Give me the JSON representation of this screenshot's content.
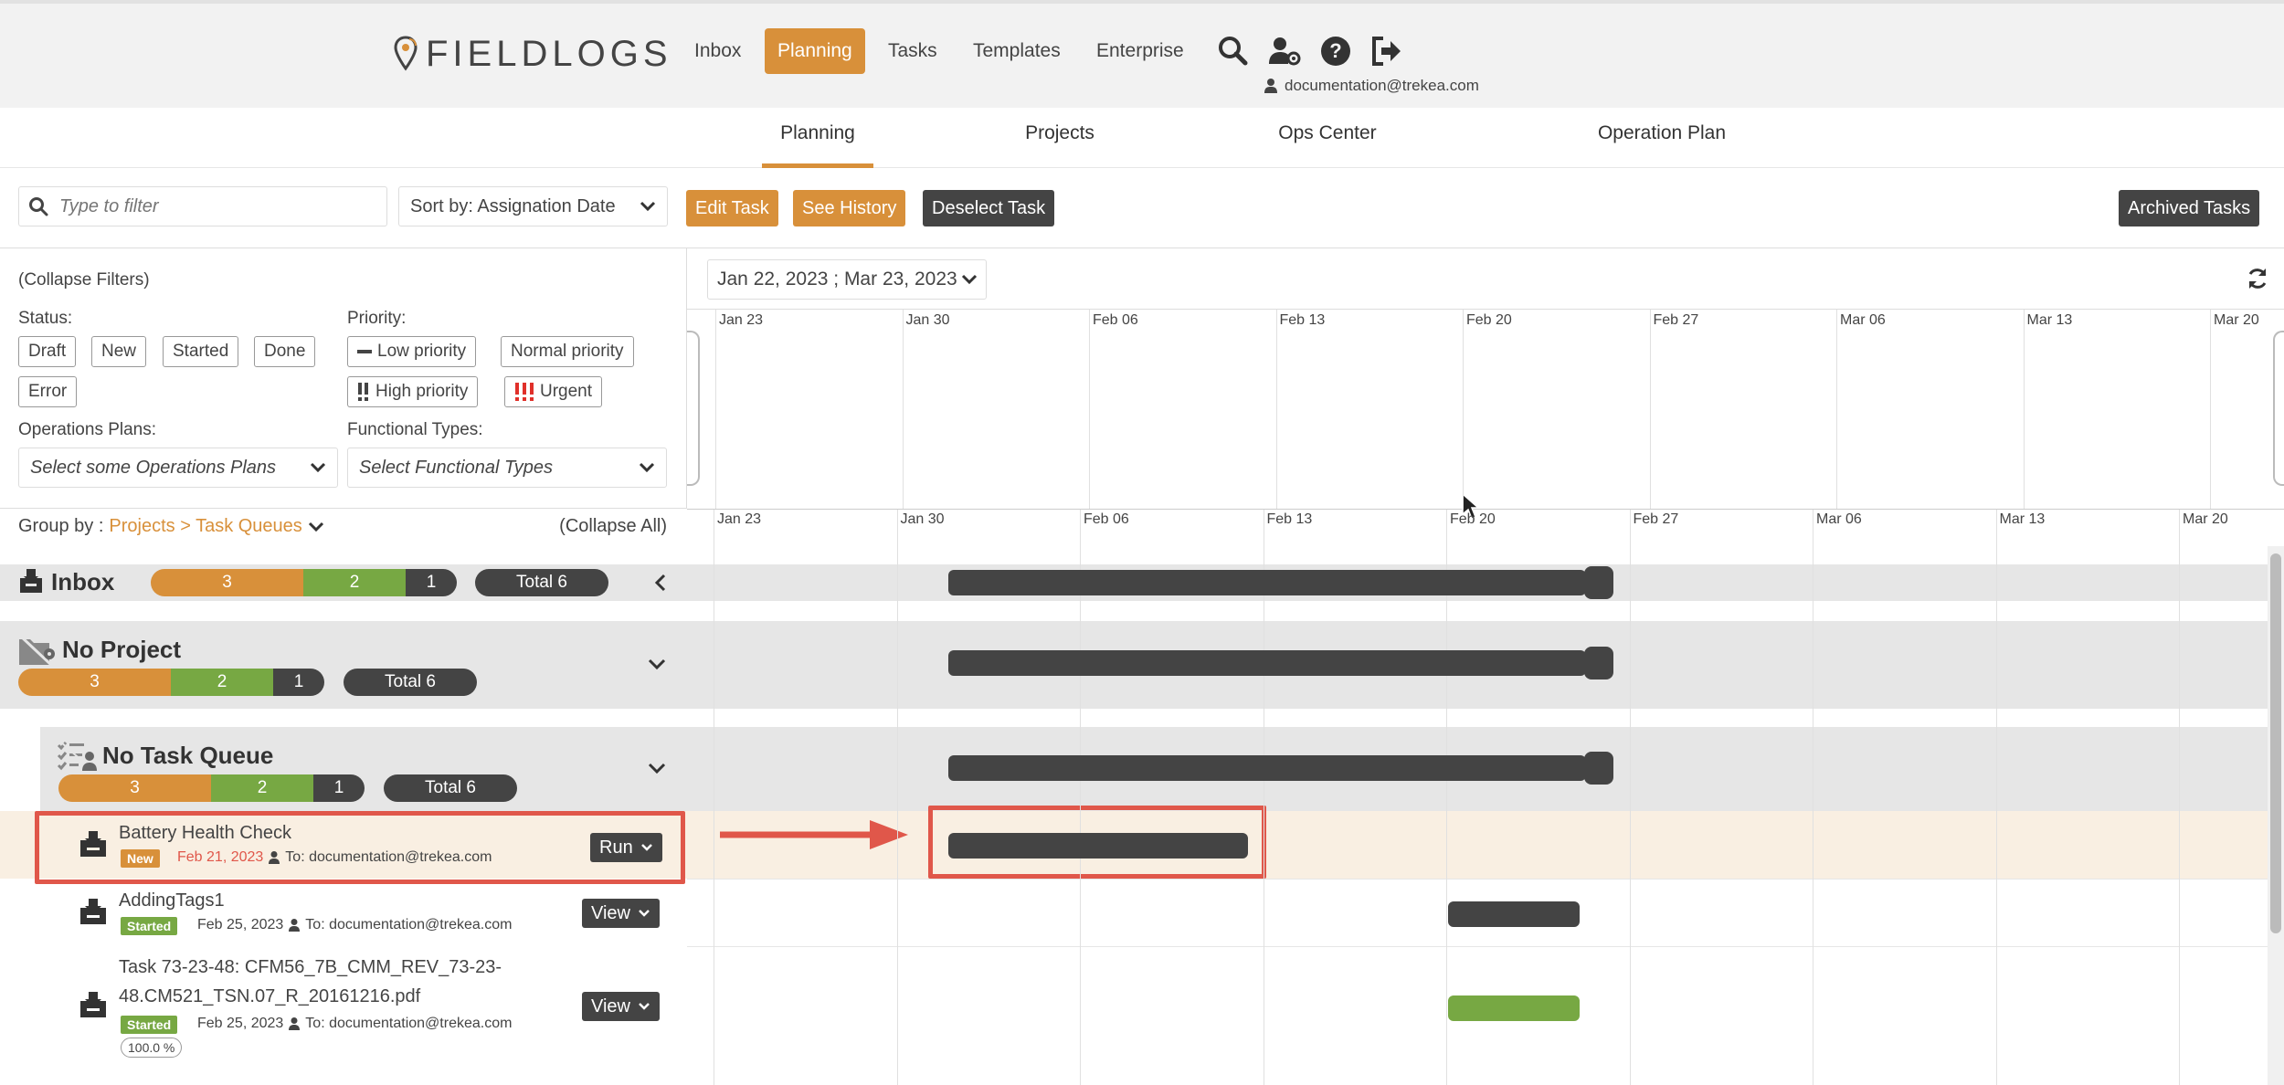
{
  "header": {
    "brand": "FIELDLOGS",
    "nav": [
      "Inbox",
      "Planning",
      "Tasks",
      "Templates",
      "Enterprise"
    ],
    "active_nav": "Planning",
    "user_email": "documentation@trekea.com"
  },
  "subnav": {
    "tabs": [
      "Planning",
      "Projects",
      "Ops Center",
      "Operation Plan"
    ],
    "active": "Planning"
  },
  "toolbar": {
    "filter_placeholder": "Type to filter",
    "sort_label": "Sort by: Assignation Date",
    "edit_task": "Edit Task",
    "see_history": "See History",
    "deselect_task": "Deselect Task",
    "archived_tasks": "Archived Tasks"
  },
  "filters": {
    "collapse": "(Collapse Filters)",
    "status_label": "Status:",
    "statuses": [
      "Draft",
      "New",
      "Started",
      "Done",
      "Error"
    ],
    "priority_label": "Priority:",
    "priorities": [
      "Low priority",
      "Normal priority",
      "High priority",
      "Urgent"
    ],
    "ops_label": "Operations Plans:",
    "ops_placeholder": "Select some Operations Plans",
    "func_label": "Functional Types:",
    "func_placeholder": "Select Functional Types"
  },
  "groupby": {
    "prefix": "Group by :",
    "value": "Projects > Task Queues",
    "collapse_all": "(Collapse All)"
  },
  "groups": {
    "inbox": {
      "title": "Inbox",
      "counts": [
        "3",
        "2",
        "1"
      ],
      "total": "Total 6"
    },
    "project": {
      "title": "No Project",
      "counts": [
        "3",
        "2",
        "1"
      ],
      "total": "Total 6"
    },
    "queue": {
      "title": "No Task Queue",
      "counts": [
        "3",
        "2",
        "1"
      ],
      "total": "Total 6"
    }
  },
  "tasks": [
    {
      "name": "Battery Health Check",
      "status": "New",
      "date": "Feb 21, 2023",
      "assignee": "To: documentation@trekea.com",
      "action": "Run"
    },
    {
      "name": "AddingTags1",
      "status": "Started",
      "date": "Feb 25, 2023",
      "assignee": "To: documentation@trekea.com",
      "action": "View"
    },
    {
      "name_line1": "Task 73-23-48: CFM56_7B_CMM_REV_73-23-",
      "name_line2": "48.CM521_TSN.07_R_20161216.pdf",
      "status": "Started",
      "date": "Feb 25, 2023",
      "assignee": "To: documentation@trekea.com",
      "action": "View",
      "progress": "100.0 %"
    }
  ],
  "timeline": {
    "range": "Jan 22, 2023 ; Mar 23, 2023",
    "ticks": [
      "Jan 23",
      "Jan 30",
      "Feb 06",
      "Feb 13",
      "Feb 20",
      "Feb 27",
      "Mar 06",
      "Mar 13",
      "Mar 20"
    ]
  },
  "colors": {
    "accent": "#d8903a",
    "green": "#77a843",
    "dark": "#444444",
    "new_red": "#e0574a",
    "highlight": "#e0574a"
  }
}
